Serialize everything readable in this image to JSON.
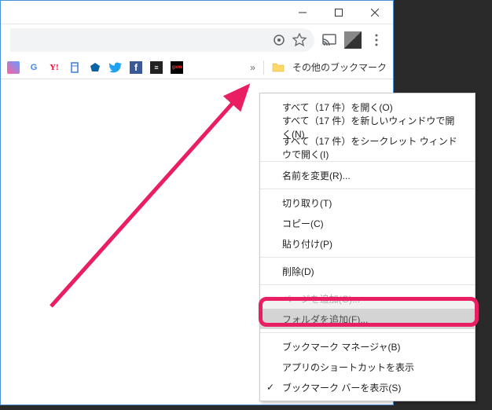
{
  "bookmarks_bar": {
    "other_bookmarks_label": "その他のブックマーク"
  },
  "context_menu": {
    "open_all": "すべて（17 件）を開く(O)",
    "open_all_new_window": "すべて（17 件）を新しいウィンドウで開く(N)",
    "open_all_incognito": "すべて（17 件）をシークレット ウィンドウで開く(I)",
    "rename": "名前を変更(R)...",
    "cut": "切り取り(T)",
    "copy": "コピー(C)",
    "paste": "貼り付け(P)",
    "delete": "削除(D)",
    "add_page": "ページを追加(G)...",
    "add_folder": "フォルダを追加(F)...",
    "bookmark_manager": "ブックマーク マネージャ(B)",
    "show_app_shortcuts": "アプリのショートカットを表示",
    "show_bookmarks_bar": "ブックマーク バーを表示(S)"
  }
}
